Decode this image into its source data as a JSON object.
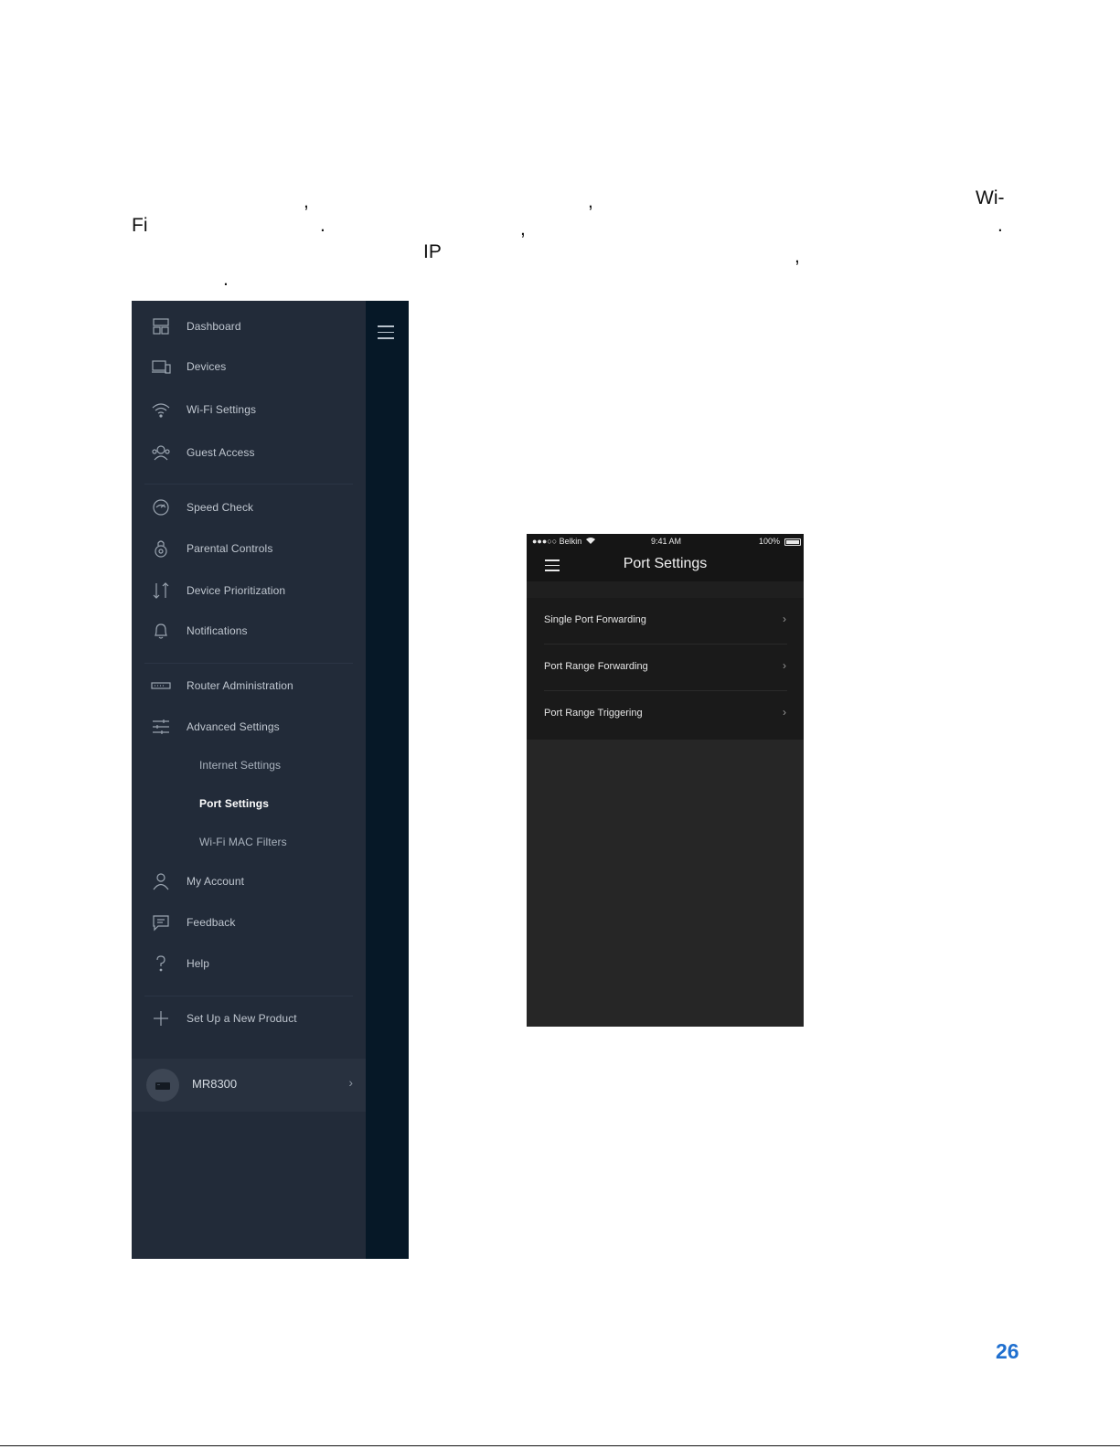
{
  "body_text": {
    "frag_comma_1": ",",
    "frag_comma_2": ",",
    "frag_wi": "Wi-",
    "frag_fi": "Fi",
    "frag_period_1": ".",
    "frag_comma_3": ",",
    "frag_period_2": ".",
    "frag_ip": "IP",
    "frag_comma_4": ",",
    "frag_period_3": "."
  },
  "sidebar": {
    "items": [
      {
        "label": "Dashboard",
        "icon": "dashboard-icon"
      },
      {
        "label": "Devices",
        "icon": "devices-icon"
      },
      {
        "label": "Wi-Fi Settings",
        "icon": "wifi-icon"
      },
      {
        "label": "Guest Access",
        "icon": "guest-icon"
      },
      {
        "label": "Speed Check",
        "icon": "speedometer-icon"
      },
      {
        "label": "Parental Controls",
        "icon": "lock-icon"
      },
      {
        "label": "Device Prioritization",
        "icon": "priority-arrows-icon"
      },
      {
        "label": "Notifications",
        "icon": "bell-icon"
      },
      {
        "label": "Router Administration",
        "icon": "router-icon"
      },
      {
        "label": "Advanced Settings",
        "icon": "sliders-icon"
      },
      {
        "label": "Internet Settings"
      },
      {
        "label": "Port Settings",
        "active": true
      },
      {
        "label": "Wi-Fi MAC Filters"
      },
      {
        "label": "My Account",
        "icon": "user-icon"
      },
      {
        "label": "Feedback",
        "icon": "chat-icon"
      },
      {
        "label": "Help",
        "icon": "help-icon"
      },
      {
        "label": "Set Up a New Product",
        "icon": "plus-icon"
      }
    ],
    "device": {
      "name": "MR8300",
      "chevron": "›"
    }
  },
  "phone": {
    "status": {
      "carrier": "●●●○○ Belkin",
      "time": "9:41 AM",
      "battery": "100%"
    },
    "title": "Port Settings",
    "rows": [
      {
        "label": "Single Port Forwarding",
        "chevron": "›"
      },
      {
        "label": "Port Range Forwarding",
        "chevron": "›"
      },
      {
        "label": "Port Range Triggering",
        "chevron": "›"
      }
    ]
  },
  "page_number": "26",
  "colors": {
    "sidebar_bg": "#222b39",
    "sidebar_strip": "#061827",
    "phone_bg": "#262626",
    "page_number": "#1f6fcf"
  }
}
